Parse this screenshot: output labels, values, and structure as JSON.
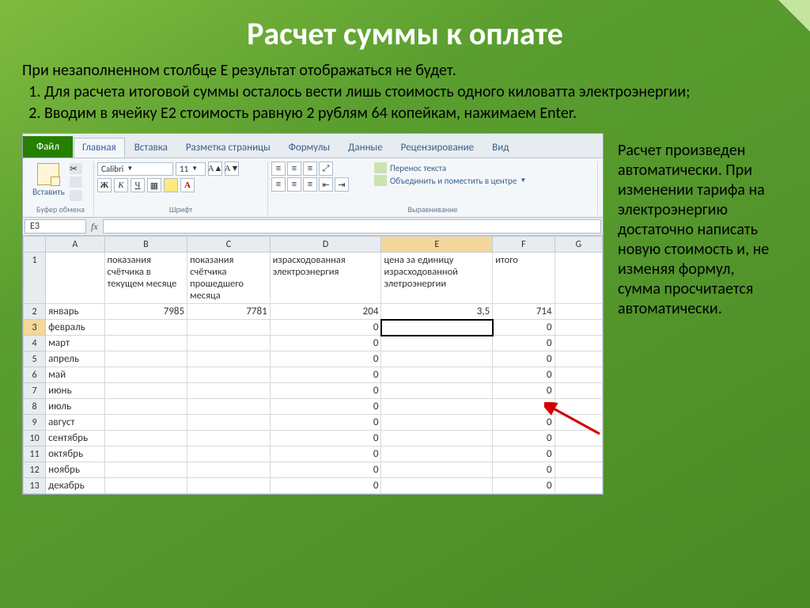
{
  "slide": {
    "title": "Расчет суммы к оплате",
    "intro_line": "При незаполненном столбце E результат отображаться не будет.",
    "bullet1": "Для расчета итоговой суммы осталось вести лишь стоимость одного киловатта электроэнергии;",
    "bullet2": "Вводим в ячейку E2 стоимость равную 2 рублям 64 копейкам, нажимаем Enter.",
    "side_text": "Расчет произведен автоматически. При изменении тарифа на электроэнергию достаточно написать новую стоимость и, не изменяя формул, сумма просчитается автоматически."
  },
  "excel": {
    "file_tab": "Файл",
    "tabs": [
      "Главная",
      "Вставка",
      "Разметка страницы",
      "Формулы",
      "Данные",
      "Рецензирование",
      "Вид"
    ],
    "active_tab": 0,
    "paste_label": "Вставить",
    "group_clipboard": "Буфер обмена",
    "group_font": "Шрифт",
    "group_align": "Выравнивание",
    "font_name": "Calibri",
    "font_size": "11",
    "wrap_text": "Перенос текста",
    "merge_text": "Объединить и поместить в центре",
    "namebox": "E3",
    "columns": [
      "A",
      "B",
      "C",
      "D",
      "E",
      "F",
      "G"
    ],
    "headers": {
      "A": "",
      "B": "показания счётчика в текущем месяце",
      "C": "показания счётчика прошедшего месяца",
      "D": "израсходованная электроэнергия",
      "E": "цена за единицу израсходованной элетроэнергии",
      "F": "итого",
      "G": ""
    },
    "rows": [
      {
        "n": 2,
        "a": "январь",
        "b": "7985",
        "c": "7781",
        "d": "204",
        "e": "3,5",
        "f": "714"
      },
      {
        "n": 3,
        "a": "февраль",
        "b": "",
        "c": "",
        "d": "0",
        "e": "",
        "f": "0"
      },
      {
        "n": 4,
        "a": "март",
        "b": "",
        "c": "",
        "d": "0",
        "e": "",
        "f": "0"
      },
      {
        "n": 5,
        "a": "апрель",
        "b": "",
        "c": "",
        "d": "0",
        "e": "",
        "f": "0"
      },
      {
        "n": 6,
        "a": "май",
        "b": "",
        "c": "",
        "d": "0",
        "e": "",
        "f": "0"
      },
      {
        "n": 7,
        "a": "июнь",
        "b": "",
        "c": "",
        "d": "0",
        "e": "",
        "f": "0"
      },
      {
        "n": 8,
        "a": "июль",
        "b": "",
        "c": "",
        "d": "0",
        "e": "",
        "f": "0"
      },
      {
        "n": 9,
        "a": "август",
        "b": "",
        "c": "",
        "d": "0",
        "e": "",
        "f": "0"
      },
      {
        "n": 10,
        "a": "сентябрь",
        "b": "",
        "c": "",
        "d": "0",
        "e": "",
        "f": "0"
      },
      {
        "n": 11,
        "a": "октябрь",
        "b": "",
        "c": "",
        "d": "0",
        "e": "",
        "f": "0"
      },
      {
        "n": 12,
        "a": "ноябрь",
        "b": "",
        "c": "",
        "d": "0",
        "e": "",
        "f": "0"
      },
      {
        "n": 13,
        "a": "декабрь",
        "b": "",
        "c": "",
        "d": "0",
        "e": "",
        "f": "0"
      }
    ]
  }
}
